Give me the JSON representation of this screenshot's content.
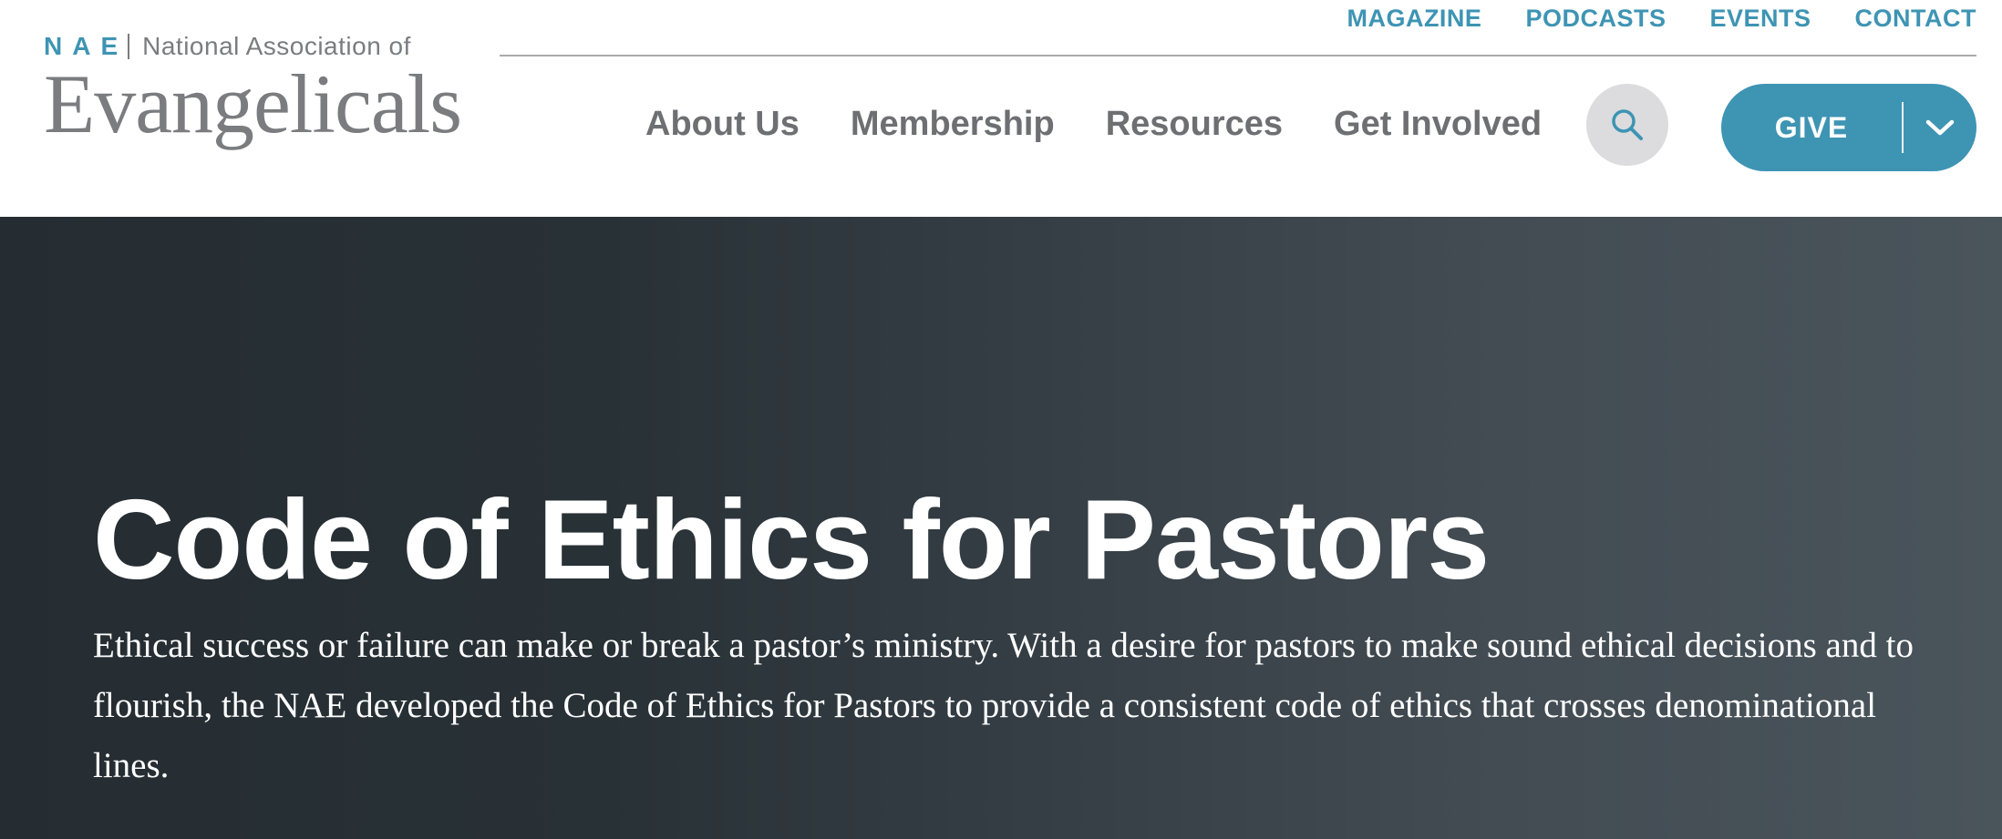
{
  "logo": {
    "abbr": "NAE",
    "line1": "National Association of",
    "main": "Evangelicals"
  },
  "utility_nav": [
    {
      "label": "MAGAZINE"
    },
    {
      "label": "PODCASTS"
    },
    {
      "label": "EVENTS"
    },
    {
      "label": "CONTACT"
    }
  ],
  "main_nav": [
    {
      "label": "About Us"
    },
    {
      "label": "Membership"
    },
    {
      "label": "Resources"
    },
    {
      "label": "Get Involved"
    }
  ],
  "search": {
    "icon": "search-icon"
  },
  "give": {
    "label": "GIVE",
    "icon": "chevron-down-icon"
  },
  "hero": {
    "title": "Code of Ethics for Pastors",
    "description": "Ethical success or failure can make or break a pastor’s ministry. With a desire for pastors to make sound ethical decisions and to flourish, the NAE developed the Code of Ethics for Pastors to provide a consistent code of ethics that crosses denominational lines."
  },
  "colors": {
    "accent": "#3e94b3",
    "nav_text": "#6d6f72",
    "logo_gray": "#7a7c7f",
    "search_bg": "#dcdcde",
    "hero_dark": "#252d32",
    "hero_light": "#4a545b"
  }
}
